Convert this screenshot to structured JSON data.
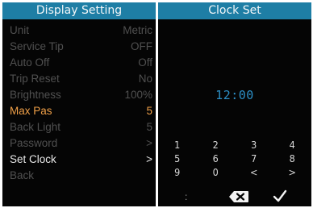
{
  "display_setting": {
    "title": "Display Setting",
    "items": [
      {
        "label": "Unit",
        "value": "Metric"
      },
      {
        "label": "Service Tip",
        "value": "OFF"
      },
      {
        "label": "Auto Off",
        "value": "Off"
      },
      {
        "label": "Trip Reset",
        "value": "No"
      },
      {
        "label": "Brightness",
        "value": "100%"
      },
      {
        "label": "Max Pas",
        "value": "5"
      },
      {
        "label": "Back Light",
        "value": "5"
      },
      {
        "label": "Password",
        "value": ">"
      },
      {
        "label": "Set Clock",
        "value": ">"
      },
      {
        "label": "Back",
        "value": ""
      }
    ],
    "selected_item": "Max Pas",
    "highlighted_item": "Set Clock"
  },
  "clock_set": {
    "title": "Clock Set",
    "time": "12:00",
    "keys": [
      "1",
      "2",
      "3",
      "4",
      "5",
      "6",
      "7",
      "8",
      "9",
      "0",
      "<",
      ">"
    ],
    "colon_key": ":",
    "backspace_icon": "backspace-icon",
    "confirm_icon": "checkmark-icon"
  },
  "colors": {
    "title_bar": "#1e7ea5",
    "selected": "#f0a048",
    "time": "#2c8fc6",
    "background": "#050505"
  }
}
